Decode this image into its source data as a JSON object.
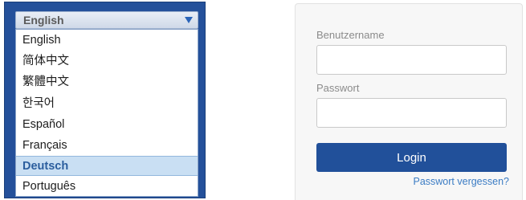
{
  "language_picker": {
    "selected_value": "English",
    "options": [
      "English",
      "简体中文",
      "繁體中文",
      "한국어",
      "Español",
      "Français",
      "Deutsch",
      "Português"
    ],
    "highlighted": "Deutsch"
  },
  "login": {
    "username_label": "Benutzername",
    "username_value": "",
    "password_label": "Passwort",
    "password_value": "",
    "login_button": "Login",
    "forgot_link": "Passwort vergessen?"
  },
  "colors": {
    "brand_blue": "#21509a",
    "link_blue": "#3b7cc4",
    "highlight": "#c9dff3"
  }
}
